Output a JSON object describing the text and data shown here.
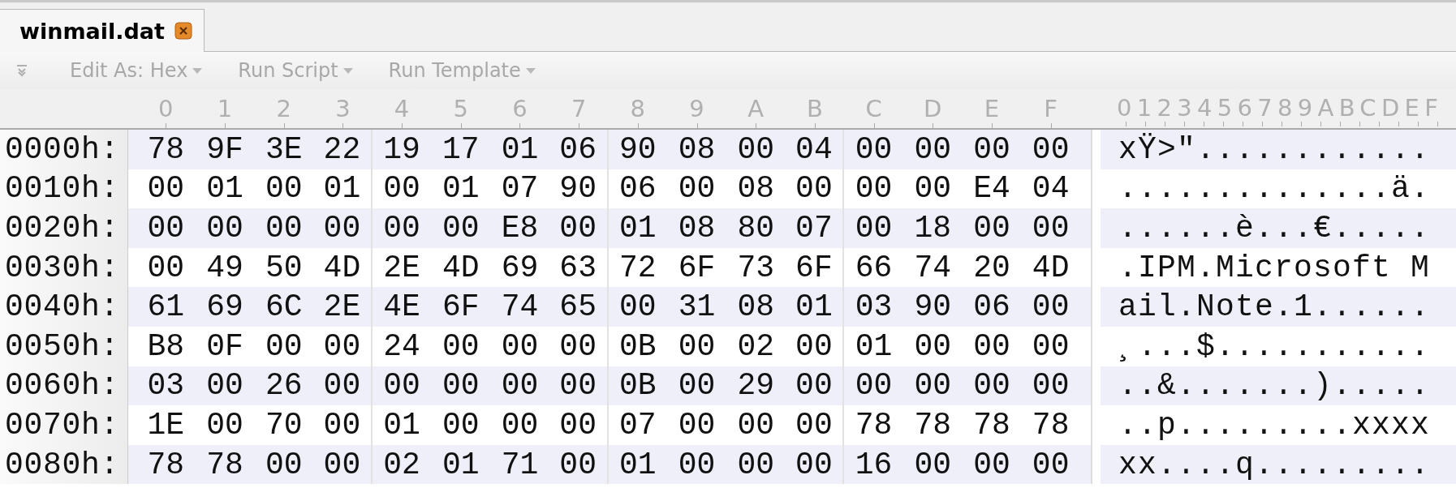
{
  "tabs": [
    {
      "label": "winmail.dat",
      "selected": true
    }
  ],
  "toolbar": {
    "menus": [
      "Edit As: Hex",
      "Run Script",
      "Run Template"
    ]
  },
  "header": {
    "columns": [
      "0",
      "1",
      "2",
      "3",
      "4",
      "5",
      "6",
      "7",
      "8",
      "9",
      "A",
      "B",
      "C",
      "D",
      "E",
      "F"
    ],
    "text_columns": "0123456789ABCDEF"
  },
  "rows": [
    {
      "offset": "0000h:",
      "bytes": [
        "78",
        "9F",
        "3E",
        "22",
        "19",
        "17",
        "01",
        "06",
        "90",
        "08",
        "00",
        "04",
        "00",
        "00",
        "00",
        "00"
      ],
      "text": "xŸ>\"............"
    },
    {
      "offset": "0010h:",
      "bytes": [
        "00",
        "01",
        "00",
        "01",
        "00",
        "01",
        "07",
        "90",
        "06",
        "00",
        "08",
        "00",
        "00",
        "00",
        "E4",
        "04"
      ],
      "text": "..............ä."
    },
    {
      "offset": "0020h:",
      "bytes": [
        "00",
        "00",
        "00",
        "00",
        "00",
        "00",
        "E8",
        "00",
        "01",
        "08",
        "80",
        "07",
        "00",
        "18",
        "00",
        "00"
      ],
      "text": "......è...€....."
    },
    {
      "offset": "0030h:",
      "bytes": [
        "00",
        "49",
        "50",
        "4D",
        "2E",
        "4D",
        "69",
        "63",
        "72",
        "6F",
        "73",
        "6F",
        "66",
        "74",
        "20",
        "4D"
      ],
      "text": ".IPM.Microsoft M"
    },
    {
      "offset": "0040h:",
      "bytes": [
        "61",
        "69",
        "6C",
        "2E",
        "4E",
        "6F",
        "74",
        "65",
        "00",
        "31",
        "08",
        "01",
        "03",
        "90",
        "06",
        "00"
      ],
      "text": "ail.Note.1......"
    },
    {
      "offset": "0050h:",
      "bytes": [
        "B8",
        "0F",
        "00",
        "00",
        "24",
        "00",
        "00",
        "00",
        "0B",
        "00",
        "02",
        "00",
        "01",
        "00",
        "00",
        "00"
      ],
      "text": "¸...$..........."
    },
    {
      "offset": "0060h:",
      "bytes": [
        "03",
        "00",
        "26",
        "00",
        "00",
        "00",
        "00",
        "00",
        "0B",
        "00",
        "29",
        "00",
        "00",
        "00",
        "00",
        "00"
      ],
      "text": "..&.......)....."
    },
    {
      "offset": "0070h:",
      "bytes": [
        "1E",
        "00",
        "70",
        "00",
        "01",
        "00",
        "00",
        "00",
        "07",
        "00",
        "00",
        "00",
        "78",
        "78",
        "78",
        "78"
      ],
      "text": "..p.........xxxx"
    },
    {
      "offset": "0080h:",
      "bytes": [
        "78",
        "78",
        "00",
        "00",
        "02",
        "01",
        "71",
        "00",
        "01",
        "00",
        "00",
        "00",
        "16",
        "00",
        "00",
        "00"
      ],
      "text": "xx....q........."
    }
  ]
}
